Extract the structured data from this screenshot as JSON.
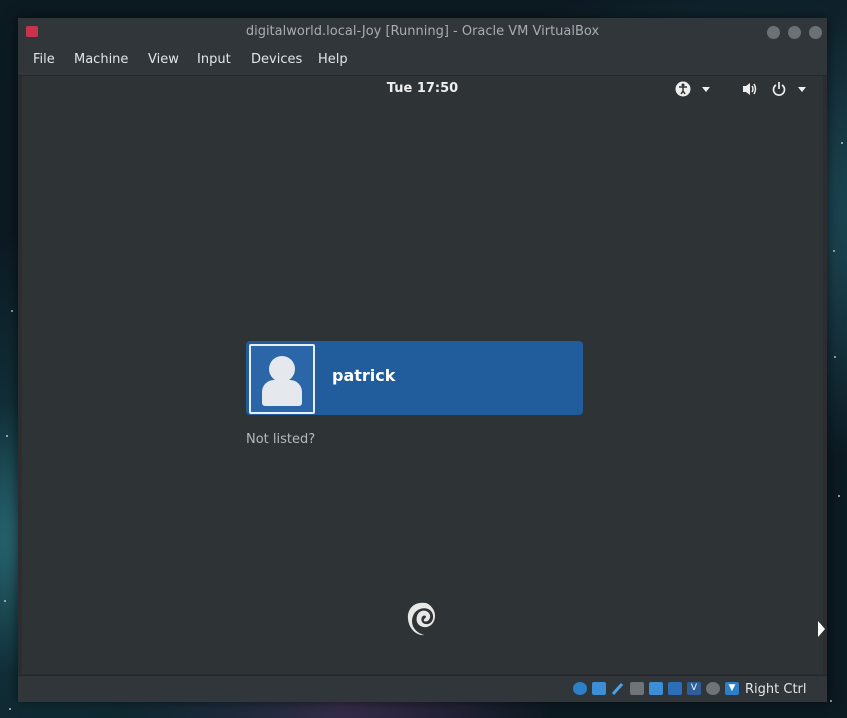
{
  "window": {
    "title": "digitalworld.local-Joy [Running] - Oracle VM VirtualBox",
    "app_icon": "virtualbox-icon"
  },
  "menubar": {
    "items": [
      "File",
      "Machine",
      "View",
      "Input",
      "Devices",
      "Help"
    ]
  },
  "guest": {
    "topbar": {
      "clock": "Tue 17:50",
      "icons": [
        "accessibility-icon",
        "volume-icon",
        "power-icon"
      ]
    },
    "login": {
      "user_name": "patrick",
      "not_listed": "Not listed?"
    },
    "logo": "debian-swirl-icon"
  },
  "statusbar": {
    "icons": [
      "hard-disk-icon",
      "network-icon",
      "usb-icon",
      "shared-folders-icon",
      "display-icon",
      "video-capture-icon",
      "vt-x-icon",
      "mouse-integration-icon",
      "host-key-icon"
    ],
    "host_key": "Right Ctrl"
  },
  "colors": {
    "login_card": "#215d9c",
    "guest_background": "#2e3436",
    "chrome": "#31363b"
  }
}
